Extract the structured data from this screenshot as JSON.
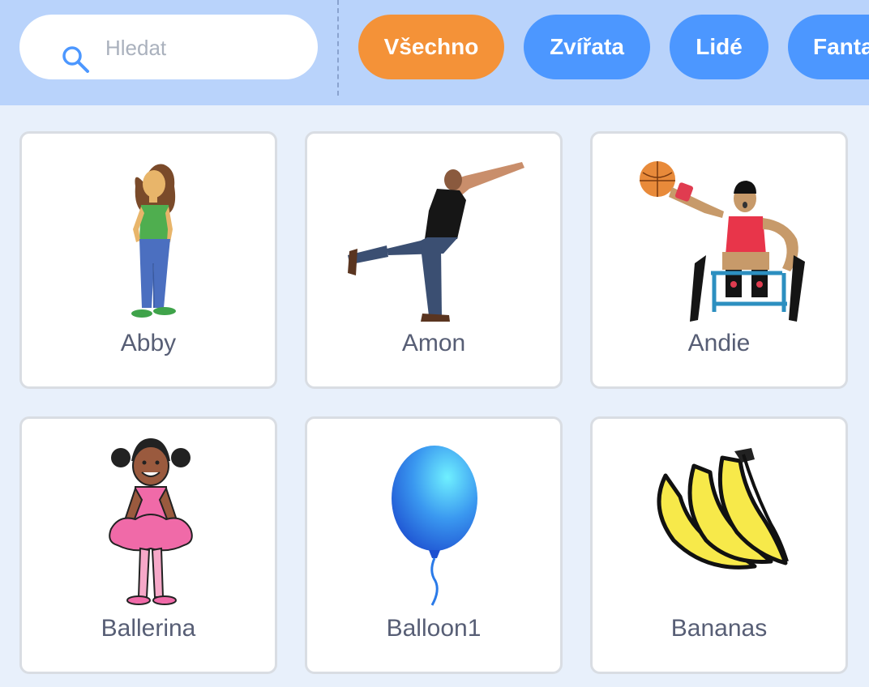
{
  "search": {
    "placeholder": "Hledat",
    "value": "",
    "icon": "search-icon"
  },
  "tabs": [
    {
      "label": "Všechno",
      "active": true
    },
    {
      "label": "Zvířata",
      "active": false
    },
    {
      "label": "Lidé",
      "active": false
    },
    {
      "label": "Fanta",
      "active": false
    }
  ],
  "sprites": [
    {
      "name": "Abby",
      "icon": "girl-figure"
    },
    {
      "name": "Amon",
      "icon": "man-reaching-figure"
    },
    {
      "name": "Andie",
      "icon": "wheelchair-basketball-figure"
    },
    {
      "name": "Ballerina",
      "icon": "ballerina-figure"
    },
    {
      "name": "Balloon1",
      "icon": "balloon-figure"
    },
    {
      "name": "Bananas",
      "icon": "bananas-figure"
    }
  ],
  "colors": {
    "header": "#b9d3fb",
    "background": "#e8f0fb",
    "tab": "#4c97ff",
    "tab_active": "#f49238",
    "label_text": "#575e75"
  }
}
